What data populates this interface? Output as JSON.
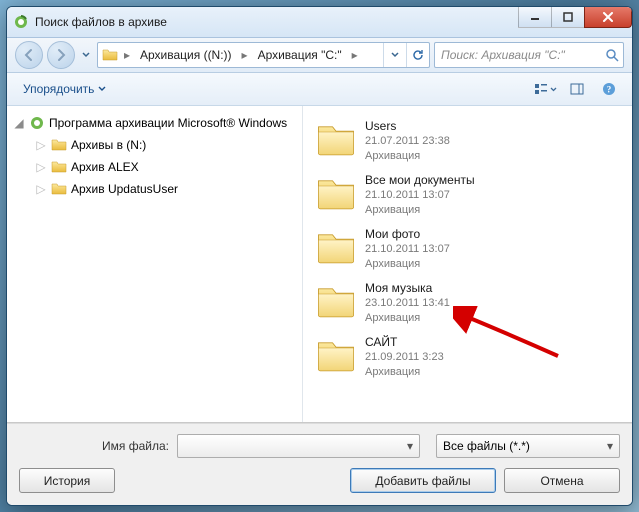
{
  "window": {
    "title": "Поиск файлов в архиве"
  },
  "nav": {
    "breadcrumb": [
      {
        "label": "Архивация ((N:))"
      },
      {
        "label": "Архивация \"C:\""
      }
    ]
  },
  "search": {
    "placeholder": "Поиск: Архивация \"C:\""
  },
  "toolbar": {
    "organize": "Упорядочить"
  },
  "tree": {
    "root": "Программа архивации Microsoft® Windows",
    "children": [
      {
        "label": "Архивы в (N:)"
      },
      {
        "label": "Архив ALEX"
      },
      {
        "label": "Архив UpdatusUser"
      }
    ]
  },
  "list": {
    "items": [
      {
        "name": "Users",
        "date": "21.07.2011 23:38",
        "type": "Архивация"
      },
      {
        "name": "Все мои документы",
        "date": "21.10.2011 13:07",
        "type": "Архивация"
      },
      {
        "name": "Мои фото",
        "date": "21.10.2011 13:07",
        "type": "Архивация"
      },
      {
        "name": "Моя музыка",
        "date": "23.10.2011 13:41",
        "type": "Архивация"
      },
      {
        "name": "САЙТ",
        "date": "21.09.2011 3:23",
        "type": "Архивация"
      }
    ]
  },
  "footer": {
    "filename_label": "Имя файла:",
    "filetypes_label": "Все файлы (*.*)",
    "history": "История",
    "add": "Добавить файлы",
    "cancel": "Отмена"
  },
  "colors": {
    "accent": "#1a4f8b"
  }
}
